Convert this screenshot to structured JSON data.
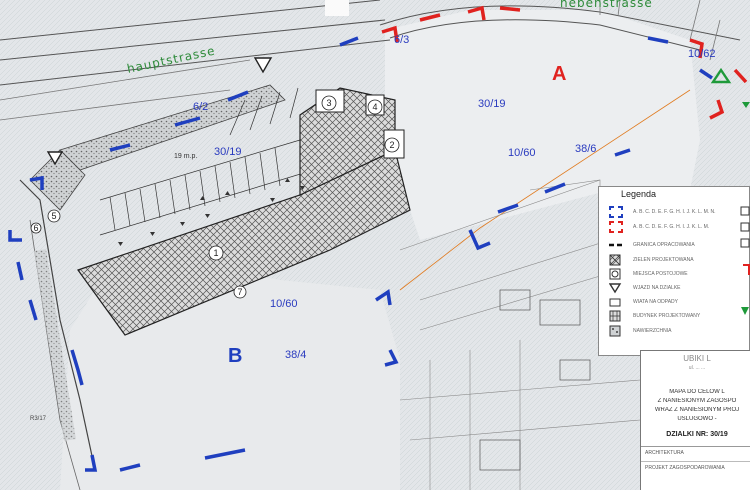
{
  "streets": {
    "main": "hauptstrasse",
    "side": "nebenstrasse"
  },
  "areas": {
    "a": {
      "label": "A",
      "color": "#e0221f"
    },
    "b": {
      "label": "B",
      "color": "#1f3fbf"
    }
  },
  "parcels": [
    "6/3",
    "10/62",
    "30/19",
    "10/60",
    "38/6",
    "6/2",
    "30/19",
    "10/60",
    "38/4"
  ],
  "buildings": [
    "1",
    "2",
    "3",
    "4",
    "5",
    "6",
    "7"
  ],
  "sheet_text": {
    "measure": "19 m.p.",
    "parcel_note": "R3/17"
  },
  "legend": {
    "title": "Legenda",
    "items": [
      {
        "symbol": "blue-corner-icon",
        "text": "A. B. C. D. E. F. G. H. I. J. K. L. M. N."
      },
      {
        "symbol": "red-corner-icon",
        "text": "A. B. C. D. E. F. G. H. I. J. K. L. M."
      },
      {
        "symbol": "dashed-line-icon",
        "text": "GRANICA OPRACOWANIA"
      },
      {
        "symbol": "hatched-square-icon",
        "text": "ZIELEN PROJEKTOWANA"
      },
      {
        "symbol": "circle-square-icon",
        "text": "MIEJSCA POSTOJOWE"
      },
      {
        "symbol": "triangle-down-icon",
        "text": "WJAZD NA DZIALKE"
      },
      {
        "symbol": "rectangle-icon",
        "text": "WIATA NA ODPADY"
      },
      {
        "symbol": "grid-square-icon",
        "text": "BUDYNEK PROJEKTOWANY"
      },
      {
        "symbol": "dotted-square-icon",
        "text": "NAWIERZCHNIA"
      }
    ],
    "colors": {
      "blue": "#1f3fbf",
      "red": "#e0221f",
      "green": "#1e9a3a"
    }
  },
  "title_block": {
    "org": "UBIKI L",
    "org_sub": "ul. ...  ...",
    "lines": [
      "MAPA DO CELOW L",
      "Z NANIESIONYM ZAGOSPO",
      "WRAZ Z NANIESIONYM PROJ",
      "USLUGOWO -"
    ],
    "plot": "DZIALKI NR: 30/19",
    "row1": "ARCHITEKTURA",
    "row2": "PROJEKT ZAGOSPODAROWANIA"
  }
}
